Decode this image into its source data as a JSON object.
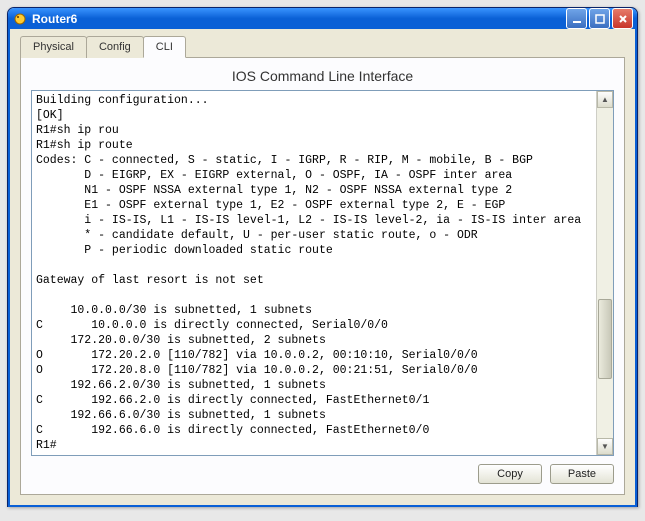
{
  "window": {
    "title": "Router6"
  },
  "tabs": {
    "physical": "Physical",
    "config": "Config",
    "cli": "CLI"
  },
  "panel": {
    "title": "IOS Command Line Interface"
  },
  "terminal": {
    "lines": [
      "Building configuration...",
      "[OK]",
      "R1#sh ip rou",
      "R1#sh ip route",
      "Codes: C - connected, S - static, I - IGRP, R - RIP, M - mobile, B - BGP",
      "       D - EIGRP, EX - EIGRP external, O - OSPF, IA - OSPF inter area",
      "       N1 - OSPF NSSA external type 1, N2 - OSPF NSSA external type 2",
      "       E1 - OSPF external type 1, E2 - OSPF external type 2, E - EGP",
      "       i - IS-IS, L1 - IS-IS level-1, L2 - IS-IS level-2, ia - IS-IS inter area",
      "       * - candidate default, U - per-user static route, o - ODR",
      "       P - periodic downloaded static route",
      "",
      "Gateway of last resort is not set",
      "",
      "     10.0.0.0/30 is subnetted, 1 subnets",
      "C       10.0.0.0 is directly connected, Serial0/0/0",
      "     172.20.0.0/30 is subnetted, 2 subnets",
      "O       172.20.2.0 [110/782] via 10.0.0.2, 00:10:10, Serial0/0/0",
      "O       172.20.8.0 [110/782] via 10.0.0.2, 00:21:51, Serial0/0/0",
      "     192.66.2.0/30 is subnetted, 1 subnets",
      "C       192.66.2.0 is directly connected, FastEthernet0/1",
      "     192.66.6.0/30 is subnetted, 1 subnets",
      "C       192.66.6.0 is directly connected, FastEthernet0/0",
      "R1#"
    ]
  },
  "buttons": {
    "copy": "Copy",
    "paste": "Paste"
  }
}
